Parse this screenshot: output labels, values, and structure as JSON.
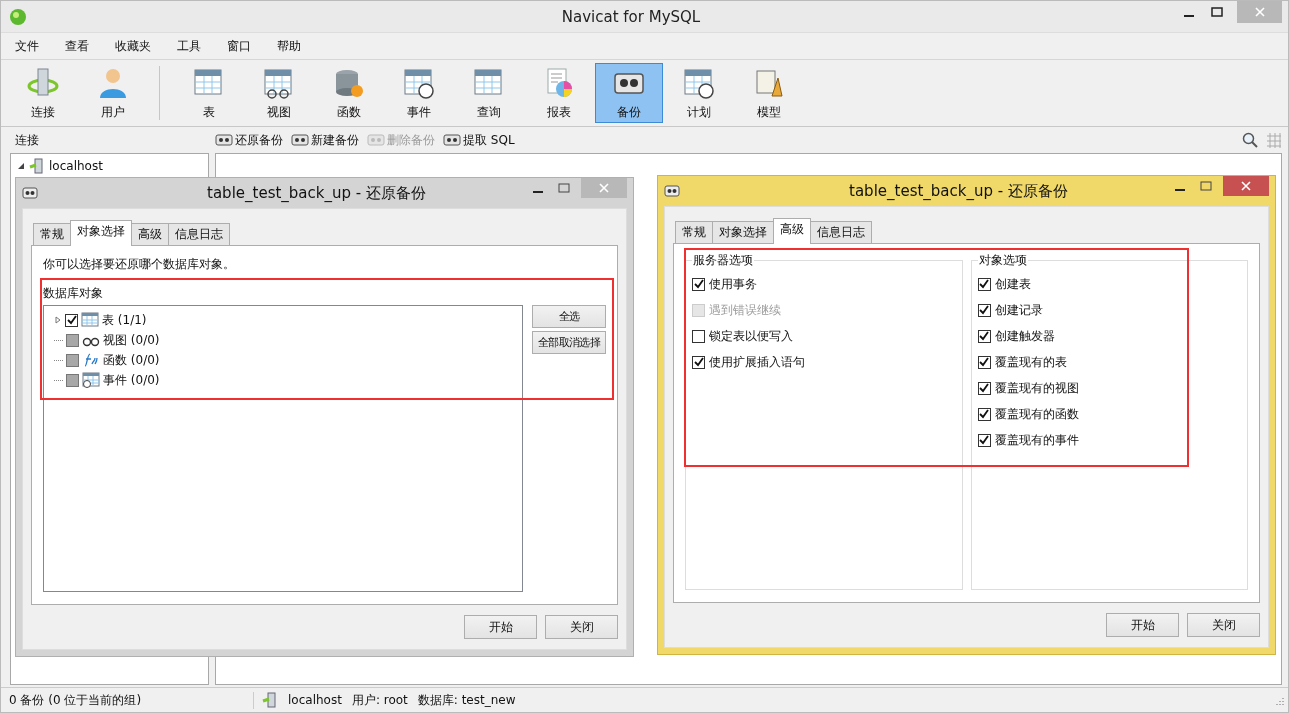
{
  "window": {
    "title": "Navicat for MySQL"
  },
  "menu": [
    "文件",
    "查看",
    "收藏夹",
    "工具",
    "窗口",
    "帮助"
  ],
  "toolbar_left": [
    {
      "label": "连接",
      "kind": "connect",
      "selected": false
    },
    {
      "label": "用户",
      "kind": "user",
      "selected": false
    }
  ],
  "toolbar_main": [
    {
      "label": "表",
      "kind": "table",
      "selected": false
    },
    {
      "label": "视图",
      "kind": "view",
      "selected": false
    },
    {
      "label": "函数",
      "kind": "function",
      "selected": false
    },
    {
      "label": "事件",
      "kind": "event",
      "selected": false
    },
    {
      "label": "查询",
      "kind": "query",
      "selected": false
    },
    {
      "label": "报表",
      "kind": "report",
      "selected": false
    },
    {
      "label": "备份",
      "kind": "backup",
      "selected": true
    },
    {
      "label": "计划",
      "kind": "schedule",
      "selected": false
    },
    {
      "label": "模型",
      "kind": "model",
      "selected": false
    }
  ],
  "sidebar": {
    "title": "连接",
    "items": [
      {
        "label": "localhost",
        "expanded": true
      }
    ]
  },
  "actions": [
    {
      "label": "还原备份",
      "disabled": false
    },
    {
      "label": "新建备份",
      "disabled": false
    },
    {
      "label": "删除备份",
      "disabled": true
    },
    {
      "label": "提取 SQL",
      "disabled": false
    }
  ],
  "dialogs": [
    {
      "title": "table_test_back_up - 还原备份",
      "active": false,
      "kind": "objects",
      "tabs": [
        {
          "label": "常规",
          "selected": false
        },
        {
          "label": "对象选择",
          "selected": true
        },
        {
          "label": "高级",
          "selected": false
        },
        {
          "label": "信息日志",
          "selected": false
        }
      ],
      "description": "你可以选择要还原哪个数据库对象。",
      "group_title": "数据库对象",
      "tree": [
        {
          "label": "表 (1/1)",
          "kind": "table",
          "checked": true,
          "expandable": true
        },
        {
          "label": "视图 (0/0)",
          "kind": "view",
          "checked": false,
          "expandable": false
        },
        {
          "label": "函数 (0/0)",
          "kind": "function",
          "checked": false,
          "expandable": false
        },
        {
          "label": "事件 (0/0)",
          "kind": "event",
          "checked": false,
          "expandable": false
        }
      ],
      "side_buttons": [
        "全选",
        "全部取消选择"
      ],
      "buttons": [
        "开始",
        "关闭"
      ]
    },
    {
      "title": "table_test_back_up - 还原备份",
      "active": true,
      "kind": "advanced",
      "tabs": [
        {
          "label": "常规",
          "selected": false
        },
        {
          "label": "对象选择",
          "selected": false
        },
        {
          "label": "高级",
          "selected": true
        },
        {
          "label": "信息日志",
          "selected": false
        }
      ],
      "groups": [
        {
          "title": "服务器选项",
          "items": [
            {
              "label": "使用事务",
              "checked": true,
              "disabled": false
            },
            {
              "label": "遇到错误继续",
              "checked": false,
              "disabled": true
            },
            {
              "label": "锁定表以便写入",
              "checked": false,
              "disabled": false
            },
            {
              "label": "使用扩展插入语句",
              "checked": true,
              "disabled": false
            }
          ]
        },
        {
          "title": "对象选项",
          "items": [
            {
              "label": "创建表",
              "checked": true,
              "disabled": false
            },
            {
              "label": "创建记录",
              "checked": true,
              "disabled": false
            },
            {
              "label": "创建触发器",
              "checked": true,
              "disabled": false
            },
            {
              "label": "覆盖现有的表",
              "checked": true,
              "disabled": false
            },
            {
              "label": "覆盖现有的视图",
              "checked": true,
              "disabled": false
            },
            {
              "label": "覆盖现有的函数",
              "checked": true,
              "disabled": false
            },
            {
              "label": "覆盖现有的事件",
              "checked": true,
              "disabled": false
            }
          ]
        }
      ],
      "buttons": [
        "开始",
        "关闭"
      ]
    }
  ],
  "status_bar": {
    "count": "0 备份 (0 位于当前的组)",
    "host": "localhost",
    "user": "用户: root",
    "database": "数据库: test_new"
  }
}
